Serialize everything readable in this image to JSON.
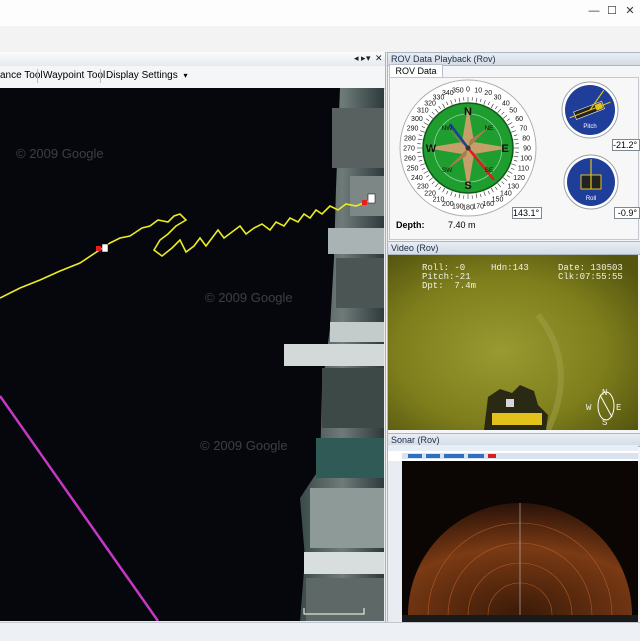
{
  "window": {
    "minimize_glyph": "—",
    "maximize_glyph": "☐",
    "close_glyph": "✕"
  },
  "map_panel": {
    "header_controls": [
      "◂ ▸",
      "▾",
      "✕"
    ],
    "toolbar": {
      "distance_tool": "ance Tool",
      "waypoint_tool": "Waypoint Tool",
      "display_settings": "Display Settings",
      "display_settings_arrow": "▾"
    },
    "watermarks": [
      "© 2009 Google",
      "© 2009 Google",
      "© 2009 Google"
    ]
  },
  "rov_panel": {
    "title": "ROV Data Playback (Rov)",
    "tab_label": "ROV Data",
    "compass": {
      "degree_labels": [
        "0",
        "10",
        "20",
        "30",
        "40",
        "50",
        "60",
        "70",
        "80",
        "90",
        "100",
        "110",
        "120",
        "130",
        "140",
        "150",
        "160",
        "170",
        "180",
        "190",
        "200",
        "210",
        "220",
        "230",
        "240",
        "250",
        "260",
        "270",
        "280",
        "290",
        "300",
        "310",
        "320",
        "330",
        "340",
        "350"
      ],
      "cardinals": [
        "N",
        "E",
        "S",
        "W"
      ],
      "intercardinals": [
        "NE",
        "SE",
        "SW",
        "NW"
      ],
      "heading_value": "143.1°"
    },
    "depth_label": "Depth:",
    "depth_value": "7.40 m",
    "pitch_label": "Pitch",
    "pitch_value": "-21.2°",
    "roll_label": "Roll",
    "roll_value": "-0.9°",
    "colors": {
      "compass_green": "#1f9d2f",
      "gauge_blue": "#1e3e9a",
      "needle_red": "#d62020"
    }
  },
  "video_panel": {
    "title": "Video (Rov)",
    "overlay": {
      "roll": "Roll: -0",
      "pitch": "Pitch:-21",
      "depth": "Dpt:  7.4m",
      "heading": "Hdn:143",
      "date": "Date: 130503",
      "clock": "Clk:07:55:55"
    },
    "compass": [
      "N",
      "E",
      "S",
      "W"
    ]
  },
  "sonar_panel": {
    "title": "Sonar (Rov)"
  }
}
